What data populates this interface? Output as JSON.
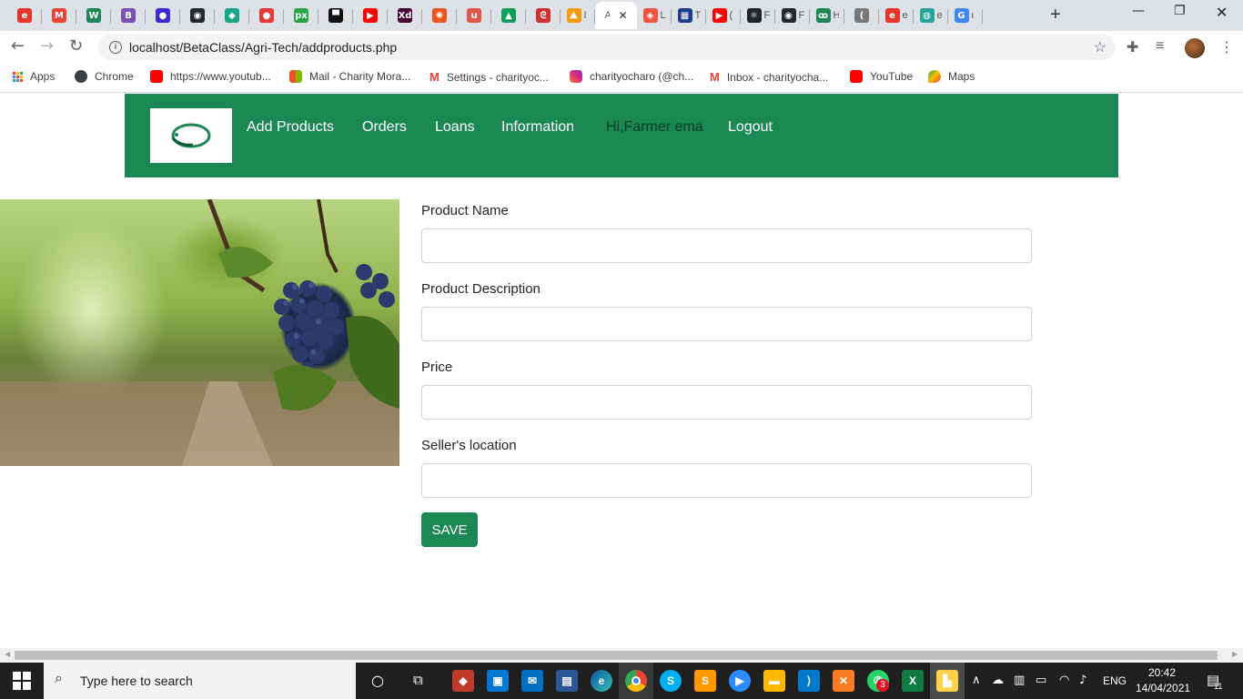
{
  "browser": {
    "tabs": [
      {
        "icon": "edge-e-icon",
        "color": "#e6342a",
        "glyph": "e",
        "title": ""
      },
      {
        "icon": "gmail-icon",
        "color": "#ea4335",
        "glyph": "M",
        "title": ""
      },
      {
        "icon": "w-icon",
        "color": "#1a8754",
        "glyph": "W",
        "title": ""
      },
      {
        "icon": "bootstrap-icon",
        "color": "#7952b3",
        "glyph": "B",
        "title": ""
      },
      {
        "icon": "circle-icon",
        "color": "#3b2bd6",
        "glyph": "●",
        "title": ""
      },
      {
        "icon": "github-icon",
        "color": "#24292e",
        "glyph": "◉",
        "title": ""
      },
      {
        "icon": "diamond-icon",
        "color": "#17a589",
        "glyph": "◆",
        "title": ""
      },
      {
        "icon": "record-icon",
        "color": "#e53935",
        "glyph": "●",
        "title": ""
      },
      {
        "icon": "px-icon",
        "color": "#28a745",
        "glyph": "px",
        "title": ""
      },
      {
        "icon": "archive-icon",
        "color": "#111111",
        "glyph": "▀",
        "title": ""
      },
      {
        "icon": "youtube-icon",
        "color": "#ff0000",
        "glyph": "▶",
        "title": ""
      },
      {
        "icon": "xd-icon",
        "color": "#470137",
        "glyph": "Xd",
        "title": ""
      },
      {
        "icon": "ubuntu-icon",
        "color": "#e95420",
        "glyph": "✺",
        "title": ""
      },
      {
        "icon": "u-icon",
        "color": "#e2574c",
        "glyph": "u",
        "title": ""
      },
      {
        "icon": "drive-icon",
        "color": "#0f9d58",
        "glyph": "▲",
        "title": ""
      },
      {
        "icon": "swirl-icon",
        "color": "#d32f2f",
        "glyph": "ᘓ",
        "title": ""
      },
      {
        "icon": "pma-icon",
        "color": "#f39c12",
        "glyph": "⛰",
        "title": "I"
      },
      {
        "icon": "blank-icon",
        "color": "#ffffff",
        "glyph": "",
        "title": "A"
      },
      {
        "icon": "laravel-icon",
        "color": "#f05340",
        "glyph": "◈",
        "title": "L"
      },
      {
        "icon": "grid-icon",
        "color": "#1e3a8a",
        "glyph": "▦",
        "title": "T"
      },
      {
        "icon": "youtube-icon",
        "color": "#ff0000",
        "glyph": "▶",
        "title": "("
      },
      {
        "icon": "react-icon",
        "color": "#20232a",
        "glyph": "⚛",
        "title": "F"
      },
      {
        "icon": "github-icon",
        "color": "#24292e",
        "glyph": "◉",
        "title": "F"
      },
      {
        "icon": "sparkle-icon",
        "color": "#1a8754",
        "glyph": "ꝏ",
        "title": "H"
      },
      {
        "icon": "audio-icon",
        "color": "#777777",
        "glyph": "(",
        "title": ""
      },
      {
        "icon": "edge-e-icon",
        "color": "#e6342a",
        "glyph": "e",
        "title": "e"
      },
      {
        "icon": "globe-icon",
        "color": "#26a69a",
        "glyph": "◍",
        "title": "e"
      },
      {
        "icon": "google-icon",
        "color": "#4285f4",
        "glyph": "G",
        "title": "ι"
      }
    ],
    "active_tab_title": "A",
    "new_tab": "+",
    "url": "localhost/BetaClass/Agri-Tech/addproducts.php",
    "bookmarks": [
      {
        "label": "Apps",
        "color": "#ea4335"
      },
      {
        "label": "Chrome",
        "color": "#3c4043"
      },
      {
        "label": "https://www.youtub...",
        "color": "#ff0000"
      },
      {
        "label": "Mail - Charity Mora...",
        "color": "#f25022"
      },
      {
        "label": "Settings - charityoc...",
        "color": "#ea4335"
      },
      {
        "label": "charityocharo (@ch...",
        "color": "#c13584"
      },
      {
        "label": "Inbox - charityocha...",
        "color": "#ea4335"
      },
      {
        "label": "YouTube",
        "color": "#ff0000"
      },
      {
        "label": "Maps",
        "color": "#34a853"
      }
    ]
  },
  "site": {
    "nav": {
      "links": [
        "Add Products",
        "Orders",
        "Loans",
        "Information"
      ],
      "greeting": "Hi,Farmer ema",
      "logout": "Logout"
    },
    "form": {
      "fields": [
        {
          "label": "Product Name",
          "value": ""
        },
        {
          "label": "Product Description",
          "value": ""
        },
        {
          "label": "Price",
          "value": ""
        },
        {
          "label": "Seller's location",
          "value": ""
        }
      ],
      "submit": "SAVE"
    },
    "brand_color": "#1a8754"
  },
  "taskbar": {
    "search_placeholder": "Type here to search",
    "language": "ENG",
    "time": "20:42",
    "date": "14/04/2021",
    "whatsapp_badge": "3",
    "notification_count": "11"
  }
}
